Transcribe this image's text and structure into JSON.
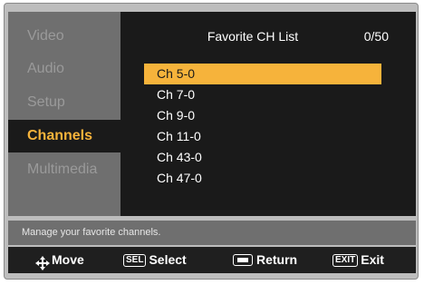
{
  "sidebar": {
    "items": [
      {
        "label": "Video",
        "active": false
      },
      {
        "label": "Audio",
        "active": false
      },
      {
        "label": "Setup",
        "active": false
      },
      {
        "label": "Channels",
        "active": true
      },
      {
        "label": "Multimedia",
        "active": false
      }
    ]
  },
  "main": {
    "title": "Favorite CH List",
    "count": "0/50",
    "channels": [
      "Ch 5-0",
      "Ch 7-0",
      "Ch 9-0",
      "Ch 11-0",
      "Ch 43-0",
      "Ch 47-0"
    ],
    "selected_index": 0
  },
  "help": {
    "text": "Manage your favorite channels."
  },
  "footer": {
    "move_label": "Move",
    "sel_key": "SEL",
    "select_label": "Select",
    "return_label": "Return",
    "exit_key": "EXIT",
    "exit_label": "Exit"
  },
  "colors": {
    "accent": "#f6b33b",
    "panel_dark": "#1a1a1a",
    "sidebar_gray": "#6f6f6f"
  }
}
